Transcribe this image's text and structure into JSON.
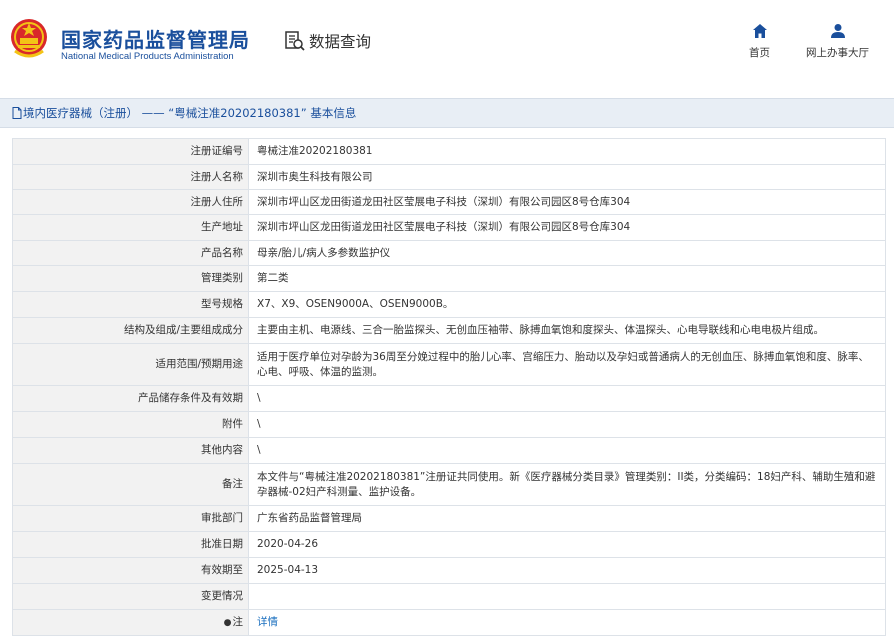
{
  "header": {
    "title_cn": "国家药品监督管理局",
    "title_en": "National Medical Products Administration",
    "search_label": "数据查询",
    "nav_home": "首页",
    "nav_hall": "网上办事大厅"
  },
  "breadcrumb": {
    "text": "境内医疗器械（注册） —— “粤械注准20202180381” 基本信息"
  },
  "rows": [
    {
      "label": "注册证编号",
      "value": "粤械注准20202180381"
    },
    {
      "label": "注册人名称",
      "value": "深圳市奥生科技有限公司"
    },
    {
      "label": "注册人住所",
      "value": "深圳市坪山区龙田街道龙田社区莹展电子科技（深圳）有限公司园区8号仓库304"
    },
    {
      "label": "生产地址",
      "value": "深圳市坪山区龙田街道龙田社区莹展电子科技（深圳）有限公司园区8号仓库304"
    },
    {
      "label": "产品名称",
      "value": "母亲/胎儿/病人多参数监护仪"
    },
    {
      "label": "管理类别",
      "value": "第二类"
    },
    {
      "label": "型号规格",
      "value": "X7、X9、OSEN9000A、OSEN9000B。"
    },
    {
      "label": "结构及组成/主要组成成分",
      "value": "主要由主机、电源线、三合一胎监探头、无创血压袖带、脉搏血氧饱和度探头、体温探头、心电导联线和心电电极片组成。"
    },
    {
      "label": "适用范围/预期用途",
      "value": "适用于医疗单位对孕龄为36周至分娩过程中的胎儿心率、宫缩压力、胎动以及孕妇或普通病人的无创血压、脉搏血氧饱和度、脉率、心电、呼吸、体温的监测。"
    },
    {
      "label": "产品储存条件及有效期",
      "value": "\\"
    },
    {
      "label": "附件",
      "value": "\\"
    },
    {
      "label": "其他内容",
      "value": "\\"
    },
    {
      "label": "备注",
      "value": "本文件与“粤械注准20202180381”注册证共同使用。新《医疗器械分类目录》管理类别：II类，分类编码：18妇产科、辅助生殖和避孕器械-02妇产科测量、监护设备。"
    },
    {
      "label": "审批部门",
      "value": "广东省药品监督管理局"
    },
    {
      "label": "批准日期",
      "value": "2020-04-26"
    },
    {
      "label": "有效期至",
      "value": "2025-04-13"
    },
    {
      "label": "变更情况",
      "value": ""
    }
  ],
  "note_row": {
    "label": "注",
    "link": "详情"
  },
  "colors": {
    "brand_blue": "#1a4f9c",
    "link_blue": "#1a6fbf",
    "label_bg": "#f2f2f2"
  }
}
